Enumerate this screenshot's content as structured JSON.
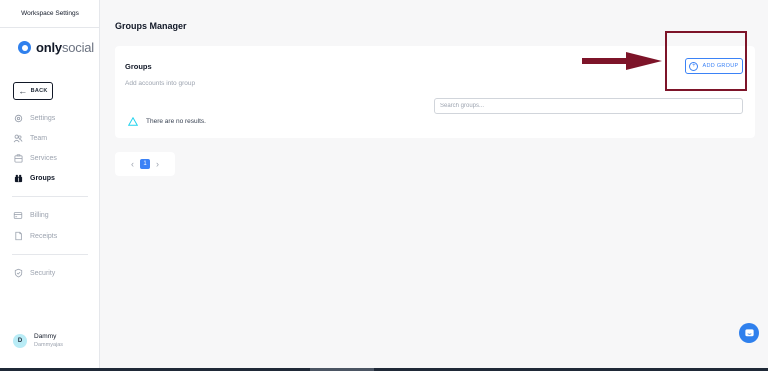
{
  "sidebar": {
    "workspace_title": "Workspace Settings",
    "logo": {
      "strong": "only",
      "light": "social",
      "brand_color": "#2f80ed"
    },
    "back_label": "BACK",
    "items": [
      {
        "label": "Settings",
        "icon": "gear-icon",
        "active": false
      },
      {
        "label": "Team",
        "icon": "users-icon",
        "active": false
      },
      {
        "label": "Services",
        "icon": "services-icon",
        "active": false
      },
      {
        "label": "Groups",
        "icon": "groups-icon",
        "active": true
      },
      {
        "label": "Billing",
        "icon": "billing-icon",
        "active": false
      },
      {
        "label": "Receipts",
        "icon": "receipt-icon",
        "active": false
      },
      {
        "label": "Security",
        "icon": "shield-icon",
        "active": false
      }
    ],
    "user": {
      "initial": "D",
      "name": "Dammy",
      "sub": "Dammyajas"
    }
  },
  "main": {
    "page_title": "Groups Manager",
    "card": {
      "title": "Groups",
      "subtitle": "Add accounts into group",
      "add_button": "ADD GROUP",
      "search_placeholder": "Search groups...",
      "empty_text": "There are no results."
    },
    "pagination": {
      "current": "1",
      "prev": "‹",
      "next": "›"
    }
  },
  "colors": {
    "accent": "#3b82f6",
    "annotation": "#7d1429",
    "alert": "#22d3ee"
  }
}
